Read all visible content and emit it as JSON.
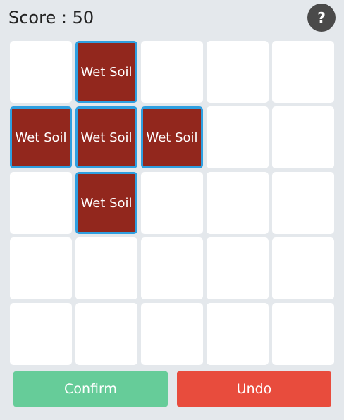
{
  "header": {
    "score_label": "Score : 50",
    "help_label": "?"
  },
  "board": {
    "rows": 5,
    "cols": 5,
    "tile_color": "#92271d",
    "highlight_color": "#2f9fe0",
    "cells": [
      [
        "",
        "Wet Soil",
        "",
        "",
        ""
      ],
      [
        "Wet Soil",
        "Wet Soil",
        "Wet Soil",
        "",
        ""
      ],
      [
        "",
        "Wet Soil",
        "",
        "",
        ""
      ],
      [
        "",
        "",
        "",
        "",
        ""
      ],
      [
        "",
        "",
        "",
        "",
        ""
      ]
    ]
  },
  "actions": {
    "confirm_label": "Confirm",
    "confirm_color": "#66cc99",
    "undo_label": "Undo",
    "undo_color": "#e84c3d"
  }
}
